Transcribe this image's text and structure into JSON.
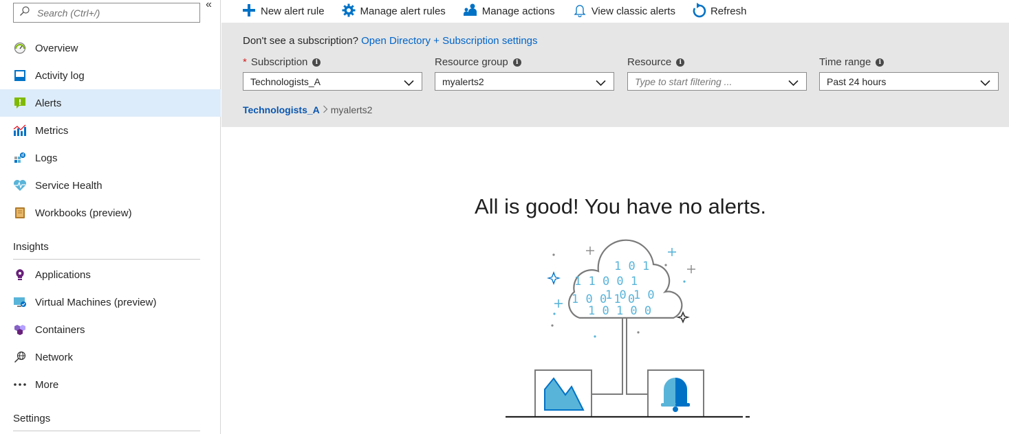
{
  "sidebar": {
    "search_placeholder": "Search (Ctrl+/)",
    "collapse_label": "«",
    "items": [
      {
        "label": "Overview",
        "icon": "overview-gauge-icon"
      },
      {
        "label": "Activity log",
        "icon": "activity-log-icon"
      },
      {
        "label": "Alerts",
        "icon": "alerts-icon",
        "active": true
      },
      {
        "label": "Metrics",
        "icon": "metrics-icon"
      },
      {
        "label": "Logs",
        "icon": "logs-icon"
      },
      {
        "label": "Service Health",
        "icon": "service-health-icon"
      },
      {
        "label": "Workbooks (preview)",
        "icon": "workbooks-icon"
      }
    ],
    "insights_heading": "Insights",
    "insights_items": [
      {
        "label": "Applications",
        "icon": "applications-icon"
      },
      {
        "label": "Virtual Machines (preview)",
        "icon": "virtual-machines-icon"
      },
      {
        "label": "Containers",
        "icon": "containers-icon"
      },
      {
        "label": "Network",
        "icon": "network-icon"
      },
      {
        "label": "More",
        "icon": "more-dots-icon"
      }
    ],
    "settings_heading": "Settings"
  },
  "toolbar": {
    "new_alert_rule": "New alert rule",
    "manage_alert_rules": "Manage alert rules",
    "manage_actions": "Manage actions",
    "view_classic_alerts": "View classic alerts",
    "refresh": "Refresh"
  },
  "filters": {
    "subscription_note": "Don't see a subscription?",
    "subscription_link": "Open Directory + Subscription settings",
    "subscription_label": "Subscription",
    "subscription_value": "Technologists_A",
    "resource_group_label": "Resource group",
    "resource_group_value": "myalerts2",
    "resource_label": "Resource",
    "resource_placeholder": "Type to start filtering ...",
    "time_range_label": "Time range",
    "time_range_value": "Past 24 hours",
    "breadcrumb_1": "Technologists_A",
    "breadcrumb_2": "myalerts2"
  },
  "empty_state": {
    "title": "All is good! You have no alerts.",
    "cloud_digits": [
      "1 0 1",
      "1 1 0 0 1",
      "1 0 1 0",
      "1 0 0 1 0",
      "1 0 1 0 0"
    ]
  },
  "colors": {
    "accent": "#0064c8",
    "active_bg": "#ddecfa",
    "filter_bg": "#e6e6e6",
    "illustration_blue": "#59b4d9",
    "illustration_dark_blue": "#0072c6"
  }
}
